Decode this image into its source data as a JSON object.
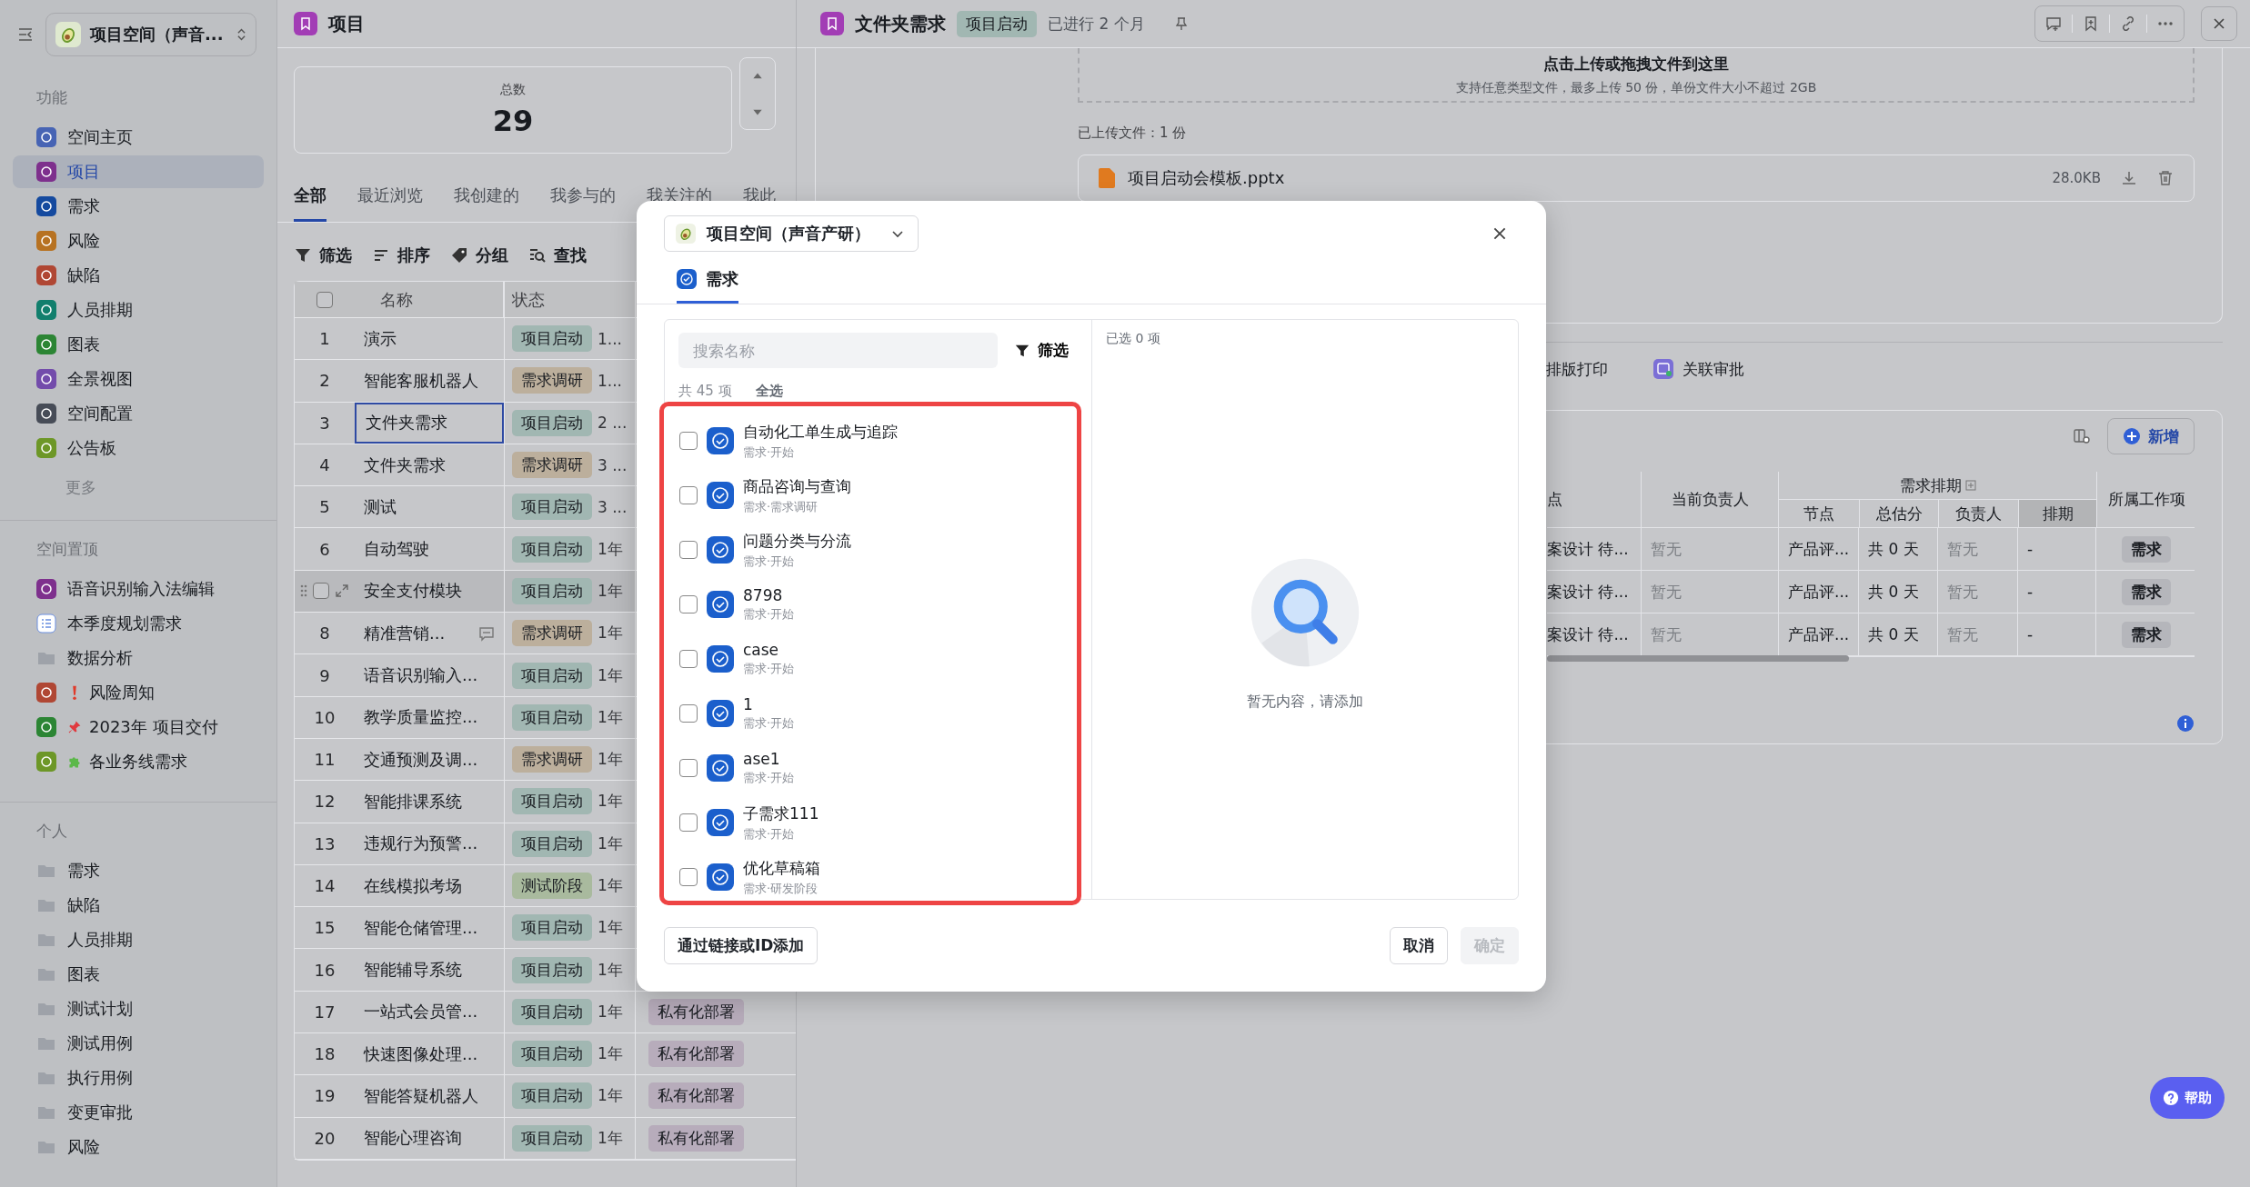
{
  "sidebar": {
    "space": "项目空间（声音...",
    "sections": [
      {
        "title": "功能",
        "more": "更多",
        "items": [
          {
            "label": "空间主页",
            "kind": "tile",
            "color": "#4764b4",
            "selected": false
          },
          {
            "label": "项目",
            "kind": "tile",
            "color": "#7e308d",
            "selected": true
          },
          {
            "label": "需求",
            "kind": "tile",
            "color": "#154a9f",
            "selected": false
          },
          {
            "label": "风险",
            "kind": "tile",
            "color": "#b77222",
            "selected": false
          },
          {
            "label": "缺陷",
            "kind": "tile",
            "color": "#b04734",
            "selected": false
          },
          {
            "label": "人员排期",
            "kind": "tile",
            "color": "#127f6d",
            "selected": false
          },
          {
            "label": "图表",
            "kind": "tile",
            "color": "#2c8534",
            "selected": false
          },
          {
            "label": "全景视图",
            "kind": "tile",
            "color": "#734cab",
            "selected": false
          },
          {
            "label": "空间配置",
            "kind": "tile",
            "color": "#474c57",
            "selected": false
          },
          {
            "label": "公告板",
            "kind": "tile",
            "color": "#6d9727",
            "selected": false
          }
        ]
      },
      {
        "title": "空间置顶",
        "items": [
          {
            "label": "语音识别输入法编辑",
            "kind": "tile",
            "color": "#7e308d",
            "selected": false
          },
          {
            "label": "本季度规划需求",
            "kind": "list",
            "selected": false
          },
          {
            "label": "数据分析",
            "kind": "folder",
            "selected": false
          },
          {
            "label": "风险周知",
            "kind": "tile-alert",
            "color": "#b04734",
            "selected": false
          },
          {
            "label": "2023年 项目交付",
            "kind": "tile-pin",
            "color": "#2c8534",
            "selected": false
          },
          {
            "label": "各业务线需求",
            "kind": "tile-puzzle",
            "color": "#6d9727",
            "selected": false
          }
        ]
      },
      {
        "title": "个人",
        "items": [
          {
            "label": "需求",
            "kind": "folder",
            "selected": false
          },
          {
            "label": "缺陷",
            "kind": "folder",
            "selected": false
          },
          {
            "label": "人员排期",
            "kind": "folder",
            "selected": false
          },
          {
            "label": "图表",
            "kind": "folder",
            "selected": false
          },
          {
            "label": "测试计划",
            "kind": "folder",
            "selected": false
          },
          {
            "label": "测试用例",
            "kind": "folder",
            "selected": false
          },
          {
            "label": "执行用例",
            "kind": "folder",
            "selected": false
          },
          {
            "label": "变更审批",
            "kind": "folder",
            "selected": false
          },
          {
            "label": "风险",
            "kind": "folder",
            "selected": false
          }
        ]
      }
    ]
  },
  "projects": {
    "title": "项目",
    "summary": {
      "label": "总数",
      "value": "29"
    },
    "tabs": [
      {
        "label": "全部",
        "selected": true
      },
      {
        "label": "最近浏览",
        "selected": false
      },
      {
        "label": "我创建的",
        "selected": false
      },
      {
        "label": "我参与的",
        "selected": false
      },
      {
        "label": "我关注的",
        "selected": false
      },
      {
        "label": "我此",
        "selected": false
      }
    ],
    "toolbar": [
      {
        "label": "筛选",
        "kind": "filter"
      },
      {
        "label": "排序",
        "kind": "sort"
      },
      {
        "label": "分组",
        "kind": "group"
      },
      {
        "label": "查找",
        "kind": "find"
      }
    ],
    "header_checked": false,
    "columns": [
      "名称",
      "状态"
    ],
    "rows": [
      {
        "no": "1",
        "name": "演示",
        "status": {
          "label": "项目启动",
          "color": "#a1b7b2"
        },
        "column_3": "1...",
        "selected": false,
        "hovered": false,
        "comment": false
      },
      {
        "no": "2",
        "name": "智能客服机器人",
        "status": {
          "label": "需求调研",
          "color": "#bcaf9c"
        },
        "column_3": "1...",
        "selected": false,
        "hovered": false,
        "comment": false
      },
      {
        "no": "3",
        "name": "文件夹需求",
        "status": {
          "label": "项目启动",
          "color": "#a1b7b2"
        },
        "column_3": "2 ...",
        "selected": true,
        "hovered": false,
        "comment": false
      },
      {
        "no": "4",
        "name": "文件夹需求",
        "status": {
          "label": "需求调研",
          "color": "#bcaf9c"
        },
        "column_3": "3 ...",
        "selected": false,
        "hovered": false,
        "comment": false
      },
      {
        "no": "5",
        "name": "测试",
        "status": {
          "label": "项目启动",
          "color": "#a1b7b2"
        },
        "column_3": "3 ...",
        "selected": false,
        "hovered": false,
        "comment": false
      },
      {
        "no": "6",
        "name": "自动驾驶",
        "status": {
          "label": "项目启动",
          "color": "#a1b7b2"
        },
        "column_3": "1年",
        "selected": false,
        "hovered": false,
        "comment": false
      },
      {
        "name": "安全支付模块",
        "status": {
          "label": "项目启动",
          "color": "#a1b7b2"
        },
        "column_3": "1年",
        "selected": false,
        "hovered": true,
        "comment": false
      },
      {
        "no": "8",
        "name": "精准营销...",
        "status": {
          "label": "需求调研",
          "color": "#bcaf9c"
        },
        "column_3": "1年",
        "selected": false,
        "hovered": false,
        "comment": true
      },
      {
        "no": "9",
        "name": "语音识别输入...",
        "status": {
          "label": "项目启动",
          "color": "#a1b7b2"
        },
        "column_3": "1年",
        "selected": false,
        "hovered": false,
        "comment": false
      },
      {
        "no": "10",
        "name": "教学质量监控...",
        "status": {
          "label": "项目启动",
          "color": "#a1b7b2"
        },
        "column_3": "1年",
        "selected": false,
        "hovered": false,
        "comment": false
      },
      {
        "no": "11",
        "name": "交通预测及调...",
        "status": {
          "label": "需求调研",
          "color": "#bcaf9c"
        },
        "column_3": "1年",
        "selected": false,
        "hovered": false,
        "comment": false
      },
      {
        "no": "12",
        "name": "智能排课系统",
        "status": {
          "label": "项目启动",
          "color": "#a1b7b2"
        },
        "column_3": "1年",
        "selected": false,
        "hovered": false,
        "comment": false
      },
      {
        "no": "13",
        "name": "违规行为预警...",
        "status": {
          "label": "项目启动",
          "color": "#a1b7b2"
        },
        "column_3": "1年",
        "selected": false,
        "hovered": false,
        "comment": false
      },
      {
        "no": "14",
        "name": "在线模拟考场",
        "status": {
          "label": "测试阶段",
          "color": "#a9ba9e"
        },
        "column_3": "1年",
        "selected": false,
        "hovered": false,
        "comment": false
      },
      {
        "no": "15",
        "name": "智能仓储管理...",
        "status": {
          "label": "项目启动",
          "color": "#a1b7b2"
        },
        "column_3": "1年",
        "selected": false,
        "hovered": false,
        "comment": false
      },
      {
        "no": "16",
        "name": "智能辅导系统",
        "status": {
          "label": "项目启动",
          "color": "#a1b7b2"
        },
        "column_3": "1年",
        "selected": false,
        "hovered": false,
        "comment": false
      },
      {
        "no": "17",
        "name": "一站式会员管...",
        "status": {
          "label": "项目启动",
          "color": "#a1b7b2"
        },
        "column_3": "1年",
        "column_4": "私有化部署",
        "selected": false,
        "hovered": false,
        "comment": false
      },
      {
        "no": "18",
        "name": "快速图像处理...",
        "status": {
          "label": "项目启动",
          "color": "#a1b7b2"
        },
        "column_3": "1年",
        "column_4": "私有化部署",
        "selected": false,
        "hovered": false,
        "comment": false
      },
      {
        "no": "19",
        "name": "智能答疑机器人",
        "status": {
          "label": "项目启动",
          "color": "#a1b7b2"
        },
        "column_3": "1年",
        "column_4": "私有化部署",
        "selected": false,
        "hovered": false,
        "comment": false
      },
      {
        "no": "20",
        "name": "智能心理咨询",
        "status": {
          "label": "项目启动",
          "color": "#a1b7b2"
        },
        "column_3": "1年",
        "column_4": "私有化部署",
        "selected": false,
        "hovered": false,
        "comment": false
      }
    ]
  },
  "detail": {
    "title": "文件夹需求",
    "status": "项目启动",
    "elapsed": "已进行 2 个月",
    "upload": {
      "title": "点击上传或拖拽文件到这里",
      "hint": "支持任意类型文件，最多上传 50 份，单份文件大小不超过 2GB"
    },
    "uploaded_label": "已上传文件：1 份",
    "files": [
      {
        "name": "项目启动会模板.pptx",
        "size": "28.0KB"
      }
    ],
    "actions": [
      {
        "label": "排版打印",
        "kind": "print"
      },
      {
        "label": "关联审批",
        "kind": "approval"
      }
    ],
    "add_button": "新增",
    "table": {
      "column_1": "点",
      "owner": "当前负责人",
      "group": "需求排期",
      "sub_columns": [
        "节点",
        "总估分",
        "负责人",
        "排期"
      ],
      "work_item": "所属工作项",
      "rows": [
        {
          "column_1": "案设计 待...",
          "owner": "暂无",
          "node": "产品评...",
          "estimate": "共 0 天",
          "assignee": "暂无",
          "schedule": "-",
          "work_item": "需求"
        },
        {
          "column_1": "案设计 待...",
          "owner": "暂无",
          "node": "产品评...",
          "estimate": "共 0 天",
          "assignee": "暂无",
          "schedule": "-",
          "work_item": "需求"
        },
        {
          "column_1": "案设计 待...",
          "owner": "暂无",
          "node": "产品评...",
          "estimate": "共 0 天",
          "assignee": "暂无",
          "schedule": "-",
          "work_item": "需求"
        }
      ]
    }
  },
  "dialog": {
    "space": "项目空间（声音产研）",
    "tabs": [
      {
        "label": "需求",
        "selected": true
      }
    ],
    "search": {
      "placeholder": "搜索名称"
    },
    "filter": "筛选",
    "count": "共 45 项",
    "select_all": "全选",
    "items": [
      {
        "title": "自动化工单生成与追踪",
        "subtitle": "需求·开始",
        "checked": false
      },
      {
        "title": "商品咨询与查询",
        "subtitle": "需求·需求调研",
        "checked": false
      },
      {
        "title": "问题分类与分流",
        "subtitle": "需求·开始",
        "checked": false
      },
      {
        "title": "8798",
        "subtitle": "需求·开始",
        "checked": false
      },
      {
        "title": "case",
        "subtitle": "需求·开始",
        "checked": false
      },
      {
        "title": "1",
        "subtitle": "需求·开始",
        "checked": false
      },
      {
        "title": "ase1",
        "subtitle": "需求·开始",
        "checked": false
      },
      {
        "title": "子需求111",
        "subtitle": "需求·开始",
        "checked": false
      },
      {
        "title": "优化草稿箱",
        "subtitle": "需求·研发阶段",
        "checked": false
      }
    ],
    "selected_label": "已选 0 项",
    "empty": "暂无内容，请添加",
    "link_add": "通过链接或ID添加",
    "cancel": "取消",
    "confirm": {
      "label": "确定",
      "disabled": true
    }
  },
  "help": "帮助"
}
